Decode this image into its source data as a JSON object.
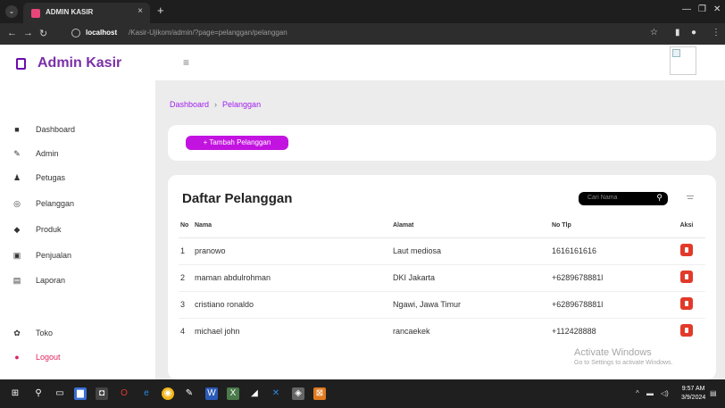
{
  "browser": {
    "tab_title": "ADMIN KASIR",
    "tab_close": "×",
    "new_tab": "+",
    "url_host": "localhost",
    "url_path": "/Kasir-Ujikom/admin/?page=pelanggan/pelanggan"
  },
  "sidebar": {
    "brand": "Admin Kasir",
    "items": [
      {
        "label": "Dashboard",
        "icon": "dashboard-icon"
      },
      {
        "label": "Admin",
        "icon": "admin-icon"
      },
      {
        "label": "Petugas",
        "icon": "petugas-icon"
      },
      {
        "label": "Pelanggan",
        "icon": "pelanggan-icon"
      },
      {
        "label": "Produk",
        "icon": "produk-icon"
      },
      {
        "label": "Penjualan",
        "icon": "penjualan-icon"
      },
      {
        "label": "Laporan",
        "icon": "laporan-icon"
      }
    ],
    "toko": "Toko",
    "logout": "Logout"
  },
  "breadcrumb": {
    "home": "Dashboard",
    "current": "Pelanggan"
  },
  "actions": {
    "add_button": "+ Tambah Pelanggan"
  },
  "table": {
    "title": "Daftar Pelanggan",
    "search_placeholder": "Cari Nama",
    "headers": [
      "No",
      "Nama",
      "Alamat",
      "No Tlp",
      "Aksi"
    ],
    "rows": [
      {
        "no": "1",
        "nama": "pranowo",
        "alamat": "Laut mediosa",
        "tlp": "1616161616"
      },
      {
        "no": "2",
        "nama": "maman abdulrohman",
        "alamat": "DKI Jakarta",
        "tlp": "+6289678881l"
      },
      {
        "no": "3",
        "nama": "cristiano ronaldo",
        "alamat": "Ngawi, Jawa Timur",
        "tlp": "+6289678881l"
      },
      {
        "no": "4",
        "nama": "michael john",
        "alamat": "rancaekek",
        "tlp": "+112428888"
      }
    ]
  },
  "watermark": {
    "line1": "Activate Windows",
    "line2": "Go to Settings to activate Windows."
  },
  "taskbar": {
    "time": "9:57 AM",
    "date": "3/9/2024"
  },
  "colors": {
    "accent": "#c313e0",
    "brand": "#7b2fa8",
    "danger": "#e23a2a"
  }
}
